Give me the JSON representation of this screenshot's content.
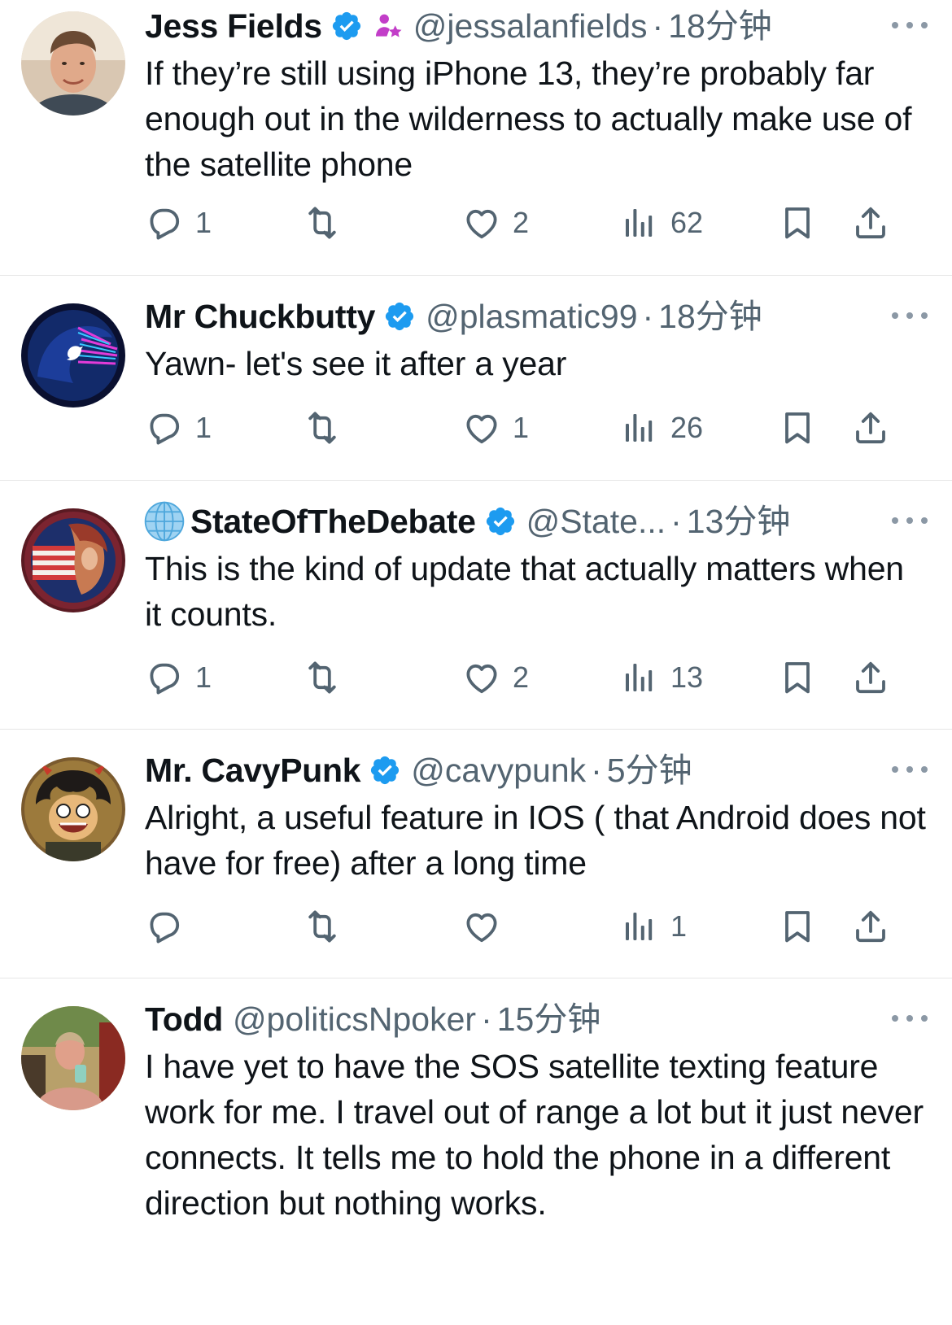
{
  "tweets": [
    {
      "name": "Jess Fields",
      "handle": "@jessalanfields",
      "time": "18分钟",
      "text": "If they’re still using iPhone 13, they’re probably far enough out in the wilderness to actually make use of the satellite phone",
      "replies": "1",
      "retweets": "",
      "likes": "2",
      "views": "62"
    },
    {
      "name": "Mr Chuckbutty",
      "handle": "@plasmatic99",
      "time": "18分钟",
      "text": "Yawn- let's see it after a year",
      "replies": "1",
      "retweets": "",
      "likes": "1",
      "views": "26"
    },
    {
      "name": "StateOfTheDebate",
      "handle": "@State...",
      "time": "13分钟",
      "text": "This is the kind of update that actually matters when it counts.",
      "replies": "1",
      "retweets": "",
      "likes": "2",
      "views": "13"
    },
    {
      "name": "Mr. CavyPunk",
      "handle": "@cavypunk",
      "time": "5分钟",
      "text": "Alright, a useful feature in IOS ( that Android does not have for free) after a long time",
      "replies": "",
      "retweets": "",
      "likes": "",
      "views": "1"
    },
    {
      "name": "Todd",
      "handle": "@politicsNpoker",
      "time": "15分钟",
      "text": "I have yet to have the SOS satellite texting feature work for me. I travel out of range a lot but it just never connects. It tells me to hold the phone in a different direction but nothing works."
    }
  ],
  "separator": "·",
  "colors": {
    "verified_blue": "#1d9bf0",
    "secondary_text": "#536471",
    "primary_text": "#0f1419",
    "badge_pink": "#c23ec8"
  },
  "icons": [
    "verified-badge-icon",
    "person-star-icon",
    "globe-icon",
    "more-icon",
    "reply-icon",
    "retweet-icon",
    "like-icon",
    "views-icon",
    "bookmark-icon",
    "share-icon"
  ]
}
